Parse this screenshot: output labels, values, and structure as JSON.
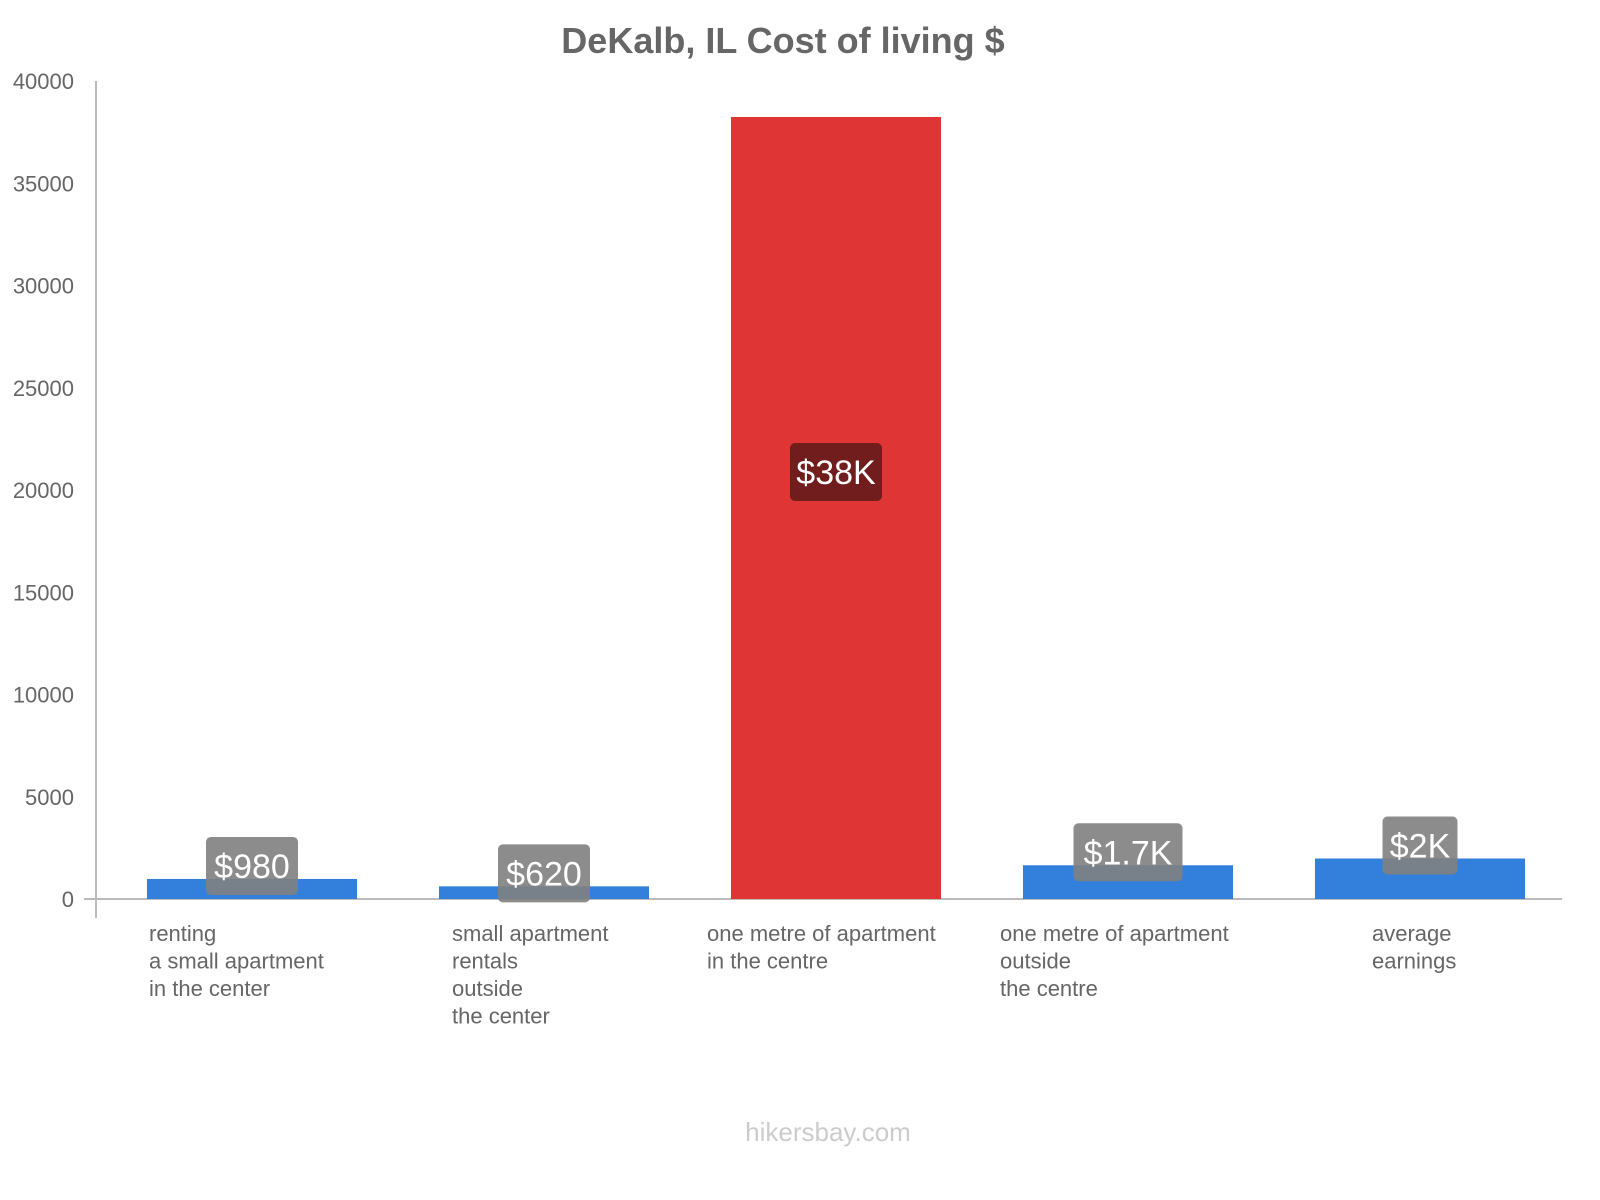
{
  "chart_data": {
    "type": "bar",
    "title": "DeKalb, IL Cost of living $",
    "xlabel": "",
    "ylabel": "",
    "ylim": [
      0,
      40000
    ],
    "yticks": [
      0,
      5000,
      10000,
      15000,
      20000,
      25000,
      30000,
      35000,
      40000
    ],
    "grid": false,
    "categories": [
      [
        "renting",
        "a small apartment",
        "in the center"
      ],
      [
        "small apartment",
        "rentals",
        "outside",
        "the center"
      ],
      [
        "one metre of apartment",
        "in the centre"
      ],
      [
        "one metre of apartment",
        "outside",
        "the centre"
      ],
      [
        "average",
        "earnings"
      ]
    ],
    "values": [
      980,
      620,
      38240,
      1650,
      1980
    ],
    "data_labels": [
      "$980",
      "$620",
      "$38K",
      "$1.7K",
      "$2K"
    ],
    "colors": [
      "#3380dc",
      "#3380dc",
      "#e03535",
      "#3380dc",
      "#3380dc"
    ],
    "label_bg": [
      "#808080",
      "#808080",
      "#721d1d",
      "#808080",
      "#808080"
    ],
    "watermark": "hikersbay.com"
  }
}
